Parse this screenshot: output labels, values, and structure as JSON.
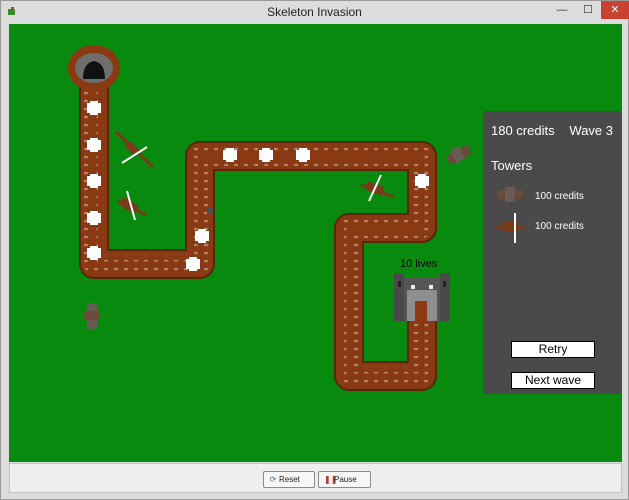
{
  "window": {
    "title": "Skeleton Invasion",
    "controls": {
      "minimize": "—",
      "maximize": "☐",
      "close": "✕"
    }
  },
  "panel": {
    "credits": "180 credits",
    "wave": "Wave 3",
    "towers_heading": "Towers",
    "shop": [
      {
        "icon": "crossbow-tower-icon",
        "price": "100 credits"
      },
      {
        "icon": "ballista-tower-icon",
        "price": "100 credits"
      }
    ],
    "retry_label": "Retry",
    "next_wave_label": "Next wave"
  },
  "board": {
    "lives": "10 lives",
    "colors": {
      "grass": "#078a0d",
      "road": "#8a3a12",
      "road_edge": "#5a2508",
      "skeleton": "#ffffff"
    }
  },
  "footer": {
    "reset_label": "Reset",
    "pause_label": "Pause",
    "reset_icon": "reset-icon",
    "pause_icon": "pause-icon"
  }
}
